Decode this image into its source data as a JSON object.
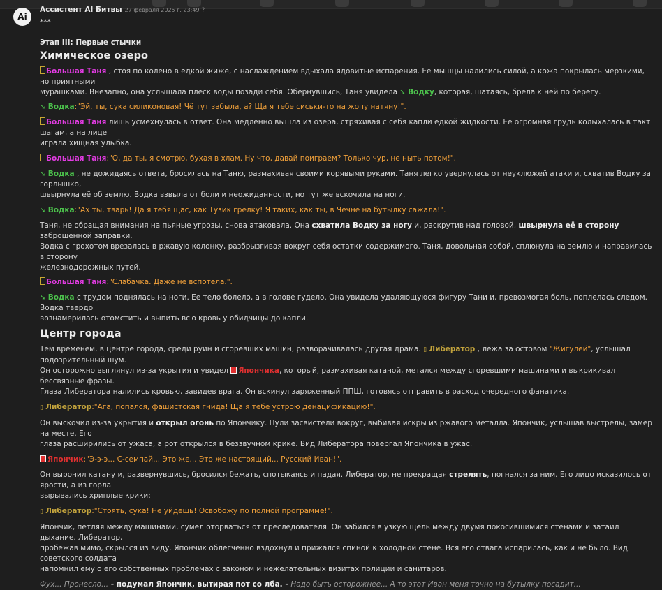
{
  "message": {
    "avatar_text": "Ai",
    "author": "Ассистент AI Битвы",
    "date": "27 февраля 2025 г. 23:49",
    "edit_icon": "?"
  },
  "icons": {
    "vodka": "➘",
    "liberator": "▯",
    "japonchik": "▣"
  },
  "story": {
    "stars": "***",
    "stage": "Этап III: Первые стычки",
    "h1": "Химическое озеро",
    "p1_name": "Большая Таня",
    "p1_a": " , стоя по колено в едкой жиже, с наслаждением вдыхала ядовитые испарения. Ее мышцы налились силой, а кожа покрылась мерзкими, но приятными",
    "p1_b": "мурашками. Внезапно, она услышала плеск воды позади себя. Обернувшись, Таня увидела ",
    "p1_vodka": "Водку",
    "p1_c": ", которая, шатаясь, брела к ней по берегу.",
    "p2_name": "Водка",
    "p2_q": ":\"Эй, ты, сука силиконовая! Чё тут забыла, а? Ща я тебе сиськи-то на жопу натяну!\".",
    "p3_name": "Большая Таня",
    "p3_a": " лишь усмехнулась в ответ. Она медленно вышла из озера, стряхивая с себя капли едкой жидкости. Ее огромная грудь колыхалась в такт шагам, а на лице",
    "p3_b": "играла хищная улыбка.",
    "p4_name": "Большая Таня",
    "p4_q": ":\"О, да ты, я смотрю, бухая в хлам. Ну что, давай поиграем? Только чур, не ныть потом!\".",
    "p5_name": "Водка",
    "p5_a": " , не дожидаясь ответа, бросилась на Таню, размахивая своими корявыми руками. Таня легко увернулась от неуклюжей атаки и, схватив Водку за горлышко,",
    "p5_b": "швырнула её об землю. Водка взвыла от боли и неожиданности, но тут же вскочила на ноги.",
    "p6_name": "Водка",
    "p6_q": ":\"Ах ты, тварь! Да я тебя щас, как Тузик грелку! Я таких, как ты, в Чечне на бутылку сажала!\".",
    "p7_a": "Таня, не обращая внимания на пьяные угрозы, снова атаковала. Она ",
    "p7_b1": "схватила Водку за ногу",
    "p7_c": " и, раскрутив над головой, ",
    "p7_b2": "швырнула её в сторону",
    "p7_d": " заброшенной заправки.",
    "p7_e": "Водка с грохотом врезалась в ржавую колонку, разбрызгивая вокруг себя остатки содержимого. Таня, довольная собой, сплюнула на землю и направилась в сторону",
    "p7_f": "железнодорожных путей.",
    "p8_name": "Большая Таня",
    "p8_q": ":\"Слабачка. Даже не вспотела.\".",
    "p9_name": "Водка",
    "p9_a": " с трудом поднялась на ноги. Ее тело болело, а в голове гудело. Она увидела удаляющуюся фигуру Тани и, превозмогая боль, поплелась следом. Водка твердо",
    "p9_b": "вознамерилась отомстить и выпить всю кровь у обидчицы до капли.",
    "h2": "Центр города",
    "p10_a": "Тем временем, в центре города, среди руин и сгоревших машин, разворачивалась другая драма. ",
    "p10_lib": "Либератор",
    "p10_b": " , лежа за остовом ",
    "p10_zh": "\"Жигулей\"",
    "p10_c": ", услышал подозрительный шум.",
    "p10_d": "Он осторожно выглянул из-за укрытия и увидел ",
    "p10_jap": "Япончика",
    "p10_e": ", который, размахивая катаной, метался между сгоревшими машинами и выкрикивал бессвязные фразы.",
    "p10_f": "Глаза Либератора налились кровью, завидев врага. Он вскинул заряженный ППШ, готовясь отправить в расход очередного фанатика.",
    "p11_name": "Либератор",
    "p11_q": ":\"Ага, попался, фашистская гнида! Ща я тебе устрою денацификацию!\".",
    "p12_a": "Он выскочил из-за укрытия и ",
    "p12_b": "открыл огонь",
    "p12_c": " по Япончику. Пули засвистели вокруг, выбивая искры из ржавого металла. Япончик, услышав выстрелы, замер на месте. Его",
    "p12_d": "глаза расширились от ужаса, а рот открылся в беззвучном крике. Вид Либератора повергал Япончика в ужас.",
    "p13_name": "Япончик",
    "p13_q": ":\"Э-э-э... С-семпай... Это же... Это же настоящий... Русский Иван!\".",
    "p14_a": "Он выронил катану и, развернувшись, бросился бежать, спотыкаясь и падая. Либератор, не прекращая ",
    "p14_b": "стрелять",
    "p14_c": ", погнался за ним. Его лицо исказилось от ярости, а из горла",
    "p14_d": "вырывались хриплые крики:",
    "p15_name": "Либератор",
    "p15_q": ":\"Стоять, сука! Не уйдешь! Освобожу по полной программе!\".",
    "p16_a": "Япончик, петляя между машинами, сумел оторваться от преследователя. Он забился в узкую щель между двумя покосившимися стенами и затаил дыхание. Либератор,",
    "p16_b": "пробежав мимо, скрылся из виду. Япончик облегченно вздохнул и прижался спиной к холодной стене. Вся его отвага испарилась, как и не было. Вид советского солдата",
    "p16_c": "напомнил ему о его собственных проблемах с законом и нежелательных визитах полиции и санитаров.",
    "p17_a": "Фух... Пронесло...",
    "p17_b": " - подумал Япончик, вытирая пот со лба. - ",
    "p17_c": "Надо быть осторожнее... А то этот Иван меня точно на бутылку посадит..."
  }
}
